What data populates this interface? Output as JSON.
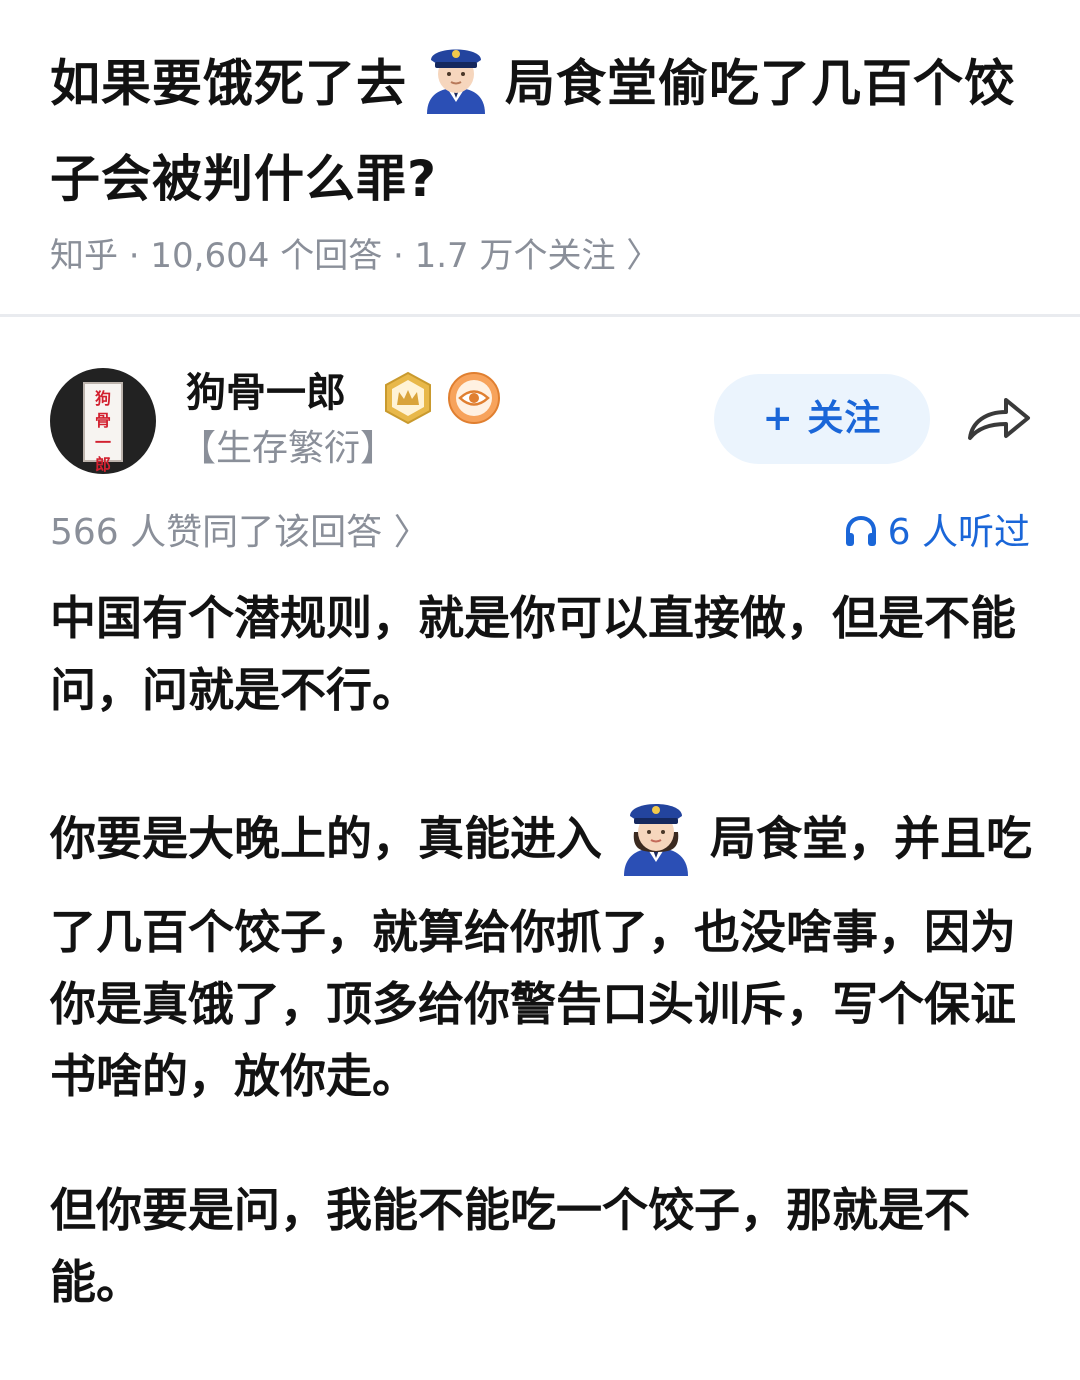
{
  "question": {
    "title_part1": "如果要饿死了去",
    "title_part2": "局食堂偷吃了几百个饺子会被判什么罪?",
    "emoji": "police-officer-male",
    "meta": "知乎 · 10,604 个回答 · 1.7 万个关注 〉"
  },
  "author": {
    "name": "狗骨一郎",
    "avatar_text": "狗\n骨\n一\n郎",
    "tag": "【生存繁衍】",
    "badges": [
      "crown-badge",
      "eye-badge"
    ],
    "follow_label": "+ 关注",
    "share_icon": "share-arrow"
  },
  "stats": {
    "agree": "566 人赞同了该回答 〉",
    "listen": "6 人听过",
    "listen_icon": "headphones"
  },
  "answer": {
    "p1": "中国有个潜规则，就是你可以直接做，但是不能问，问就是不行。",
    "p2_before": "你要是大晚上的，真能进入",
    "p2_emoji": "police-officer-female",
    "p2_after": "局食堂，并且吃了几百个饺子，就算给你抓了，也没啥事，因为你是真饿了，顶多给你警告口头训斥，写个保证书啥的，放你走。",
    "p3": "但你要是问，我能不能吃一个饺子，那就是不能。"
  },
  "colors": {
    "text": "#121212",
    "muted": "#8a8f99",
    "accent": "#1a66d8",
    "follow_bg": "#ebf4fd",
    "divider": "#e9ebef"
  }
}
